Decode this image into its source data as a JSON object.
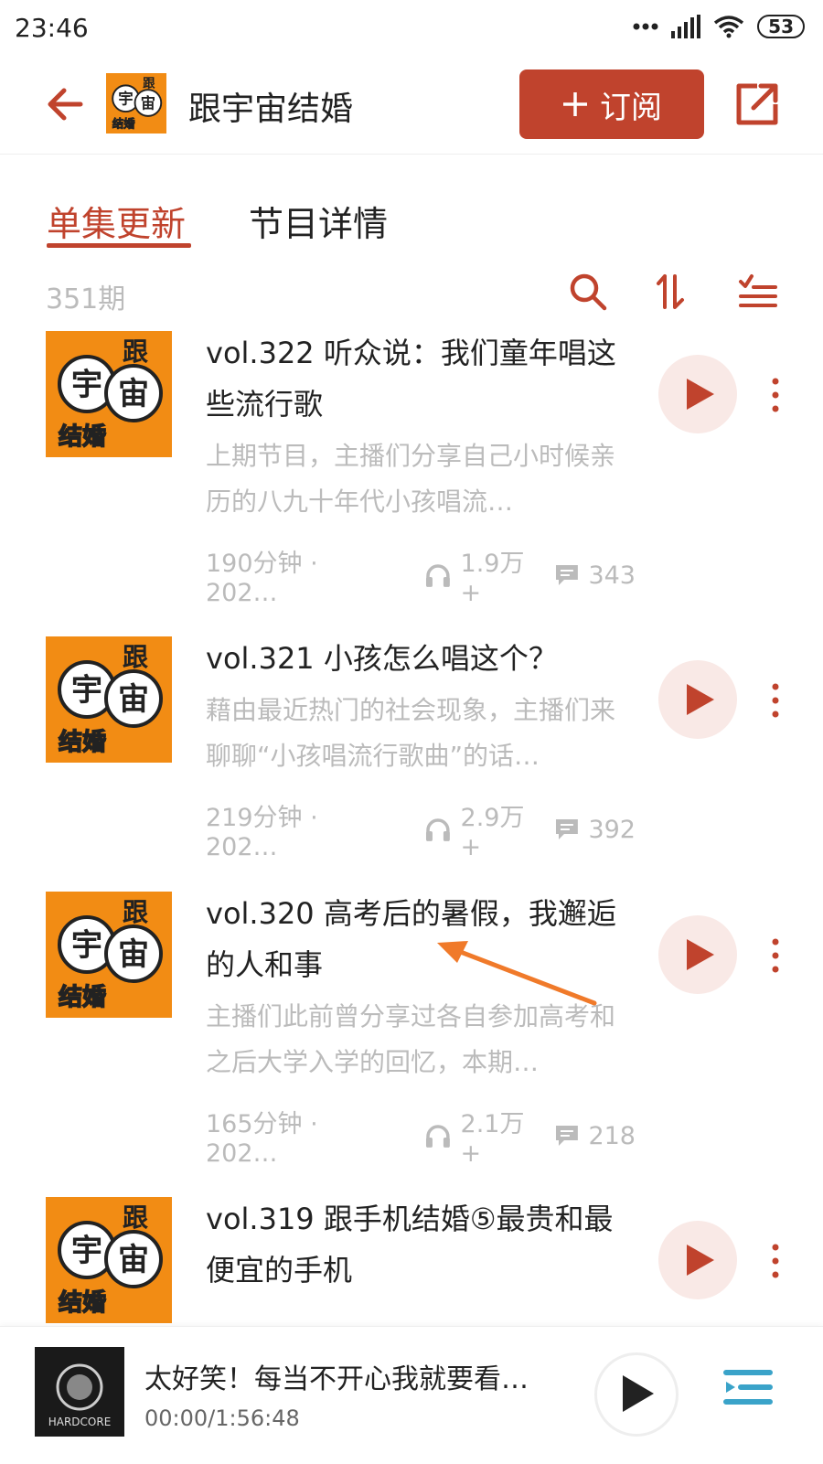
{
  "status_bar": {
    "time": "23:46",
    "battery": "53"
  },
  "header": {
    "title": "跟宇宙结婚",
    "subscribe_label": "订阅"
  },
  "cover_art": {
    "c1": "跟",
    "c2": "宇",
    "c3": "宙",
    "c4": "结婚"
  },
  "tabs": [
    {
      "label": "单集更新",
      "active": true
    },
    {
      "label": "节目详情",
      "active": false
    }
  ],
  "episode_count": "351期",
  "episodes": [
    {
      "title": "vol.322 听众说：我们童年唱这些流行歌",
      "desc": "上期节目，主播们分享自己小时候亲历的八九十年代小孩唱流…",
      "duration": "190分钟 · 202…",
      "plays": "1.9万+",
      "comments": "343"
    },
    {
      "title": "vol.321 小孩怎么唱这个？",
      "desc": "藉由最近热门的社会现象，主播们来聊聊“小孩唱流行歌曲”的话…",
      "duration": "219分钟 · 202…",
      "plays": "2.9万+",
      "comments": "392"
    },
    {
      "title": "vol.320 高考后的暑假，我邂逅的人和事",
      "desc": "主播们此前曾分享过各自参加高考和之后大学入学的回忆，本期…",
      "duration": "165分钟 · 202…",
      "plays": "2.1万+",
      "comments": "218"
    },
    {
      "title": "vol.319 跟手机结婚⑤最贵和最便宜的手机",
      "desc": "",
      "duration": "",
      "plays": "",
      "comments": ""
    }
  ],
  "player": {
    "title": "太好笑！每当不开心我就要看…",
    "time": "00:00/1:56:48",
    "cover_text": "HARDCORE"
  },
  "colors": {
    "accent": "#c0432d",
    "cover_bg": "#f28c14",
    "muted": "#bbbbbb"
  }
}
